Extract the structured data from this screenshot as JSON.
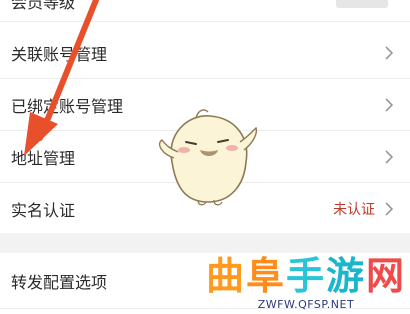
{
  "settings": {
    "rows": [
      {
        "label": "会员等级",
        "status": ""
      },
      {
        "label": "关联账号管理",
        "status": ""
      },
      {
        "label": "已绑定账号管理",
        "status": ""
      },
      {
        "label": "地址管理",
        "status": ""
      },
      {
        "label": "实名认证",
        "status": "未认证"
      },
      {
        "label": "转发配置选项",
        "status": ""
      }
    ]
  },
  "watermark": {
    "chars": [
      "曲",
      "阜",
      "手",
      "游",
      "网"
    ],
    "url": "ZWFW.QFSP.NET"
  },
  "colors": {
    "arrow": "#e8502b",
    "status": "#c0392b",
    "band": "#f2f2f2"
  },
  "icons": [
    "chevron-right-icon",
    "red-arrow-annotation",
    "mascot-sticker"
  ]
}
